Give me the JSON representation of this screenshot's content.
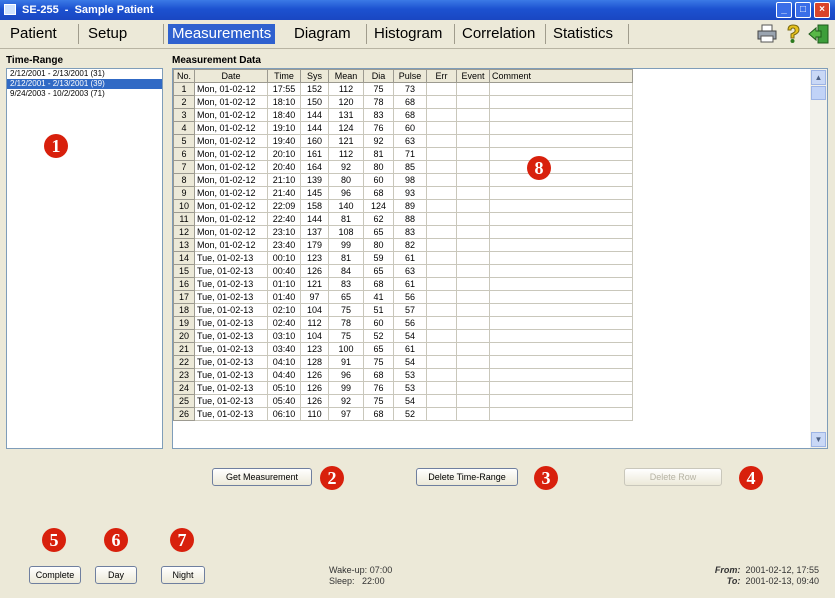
{
  "window": {
    "title": "SE-255  -  Sample Patient"
  },
  "menu": {
    "items": [
      "Patient",
      "Setup",
      "Measurements",
      "Diagram",
      "Histogram",
      "Correlation",
      "Statistics"
    ],
    "active": "Measurements"
  },
  "toolbar": {
    "icons": [
      "printer-icon",
      "help-icon",
      "exit-icon"
    ]
  },
  "time_range": {
    "label": "Time-Range",
    "items": [
      "2/12/2001 - 2/13/2001 (31)",
      "2/12/2001 - 2/13/2001 (39)",
      "9/24/2003 - 10/2/2003 (71)"
    ],
    "selected_index": 1
  },
  "measurement_data": {
    "label": "Measurement Data",
    "columns": [
      "No.",
      "Date",
      "Time",
      "Sys",
      "Mean",
      "Dia",
      "Pulse",
      "Err",
      "Event",
      "Comment"
    ],
    "rows": [
      [
        "1",
        "Mon, 01-02-12",
        "17:55",
        "152",
        "112",
        "75",
        "73"
      ],
      [
        "2",
        "Mon, 01-02-12",
        "18:10",
        "150",
        "120",
        "78",
        "68"
      ],
      [
        "3",
        "Mon, 01-02-12",
        "18:40",
        "144",
        "131",
        "83",
        "68"
      ],
      [
        "4",
        "Mon, 01-02-12",
        "19:10",
        "144",
        "124",
        "76",
        "60"
      ],
      [
        "5",
        "Mon, 01-02-12",
        "19:40",
        "160",
        "121",
        "92",
        "63"
      ],
      [
        "6",
        "Mon, 01-02-12",
        "20:10",
        "161",
        "112",
        "81",
        "71"
      ],
      [
        "7",
        "Mon, 01-02-12",
        "20:40",
        "164",
        "92",
        "80",
        "85"
      ],
      [
        "8",
        "Mon, 01-02-12",
        "21:10",
        "139",
        "80",
        "60",
        "98"
      ],
      [
        "9",
        "Mon, 01-02-12",
        "21:40",
        "145",
        "96",
        "68",
        "93"
      ],
      [
        "10",
        "Mon, 01-02-12",
        "22:09",
        "158",
        "140",
        "124",
        "89"
      ],
      [
        "11",
        "Mon, 01-02-12",
        "22:40",
        "144",
        "81",
        "62",
        "88"
      ],
      [
        "12",
        "Mon, 01-02-12",
        "23:10",
        "137",
        "108",
        "65",
        "83"
      ],
      [
        "13",
        "Mon, 01-02-12",
        "23:40",
        "179",
        "99",
        "80",
        "82"
      ],
      [
        "14",
        "Tue, 01-02-13",
        "00:10",
        "123",
        "81",
        "59",
        "61"
      ],
      [
        "15",
        "Tue, 01-02-13",
        "00:40",
        "126",
        "84",
        "65",
        "63"
      ],
      [
        "16",
        "Tue, 01-02-13",
        "01:10",
        "121",
        "83",
        "68",
        "61"
      ],
      [
        "17",
        "Tue, 01-02-13",
        "01:40",
        "97",
        "65",
        "41",
        "56"
      ],
      [
        "18",
        "Tue, 01-02-13",
        "02:10",
        "104",
        "75",
        "51",
        "57"
      ],
      [
        "19",
        "Tue, 01-02-13",
        "02:40",
        "112",
        "78",
        "60",
        "56"
      ],
      [
        "20",
        "Tue, 01-02-13",
        "03:10",
        "104",
        "75",
        "52",
        "54"
      ],
      [
        "21",
        "Tue, 01-02-13",
        "03:40",
        "123",
        "100",
        "65",
        "61"
      ],
      [
        "22",
        "Tue, 01-02-13",
        "04:10",
        "128",
        "91",
        "75",
        "54"
      ],
      [
        "23",
        "Tue, 01-02-13",
        "04:40",
        "126",
        "96",
        "68",
        "53"
      ],
      [
        "24",
        "Tue, 01-02-13",
        "05:10",
        "126",
        "99",
        "76",
        "53"
      ],
      [
        "25",
        "Tue, 01-02-13",
        "05:40",
        "126",
        "92",
        "75",
        "54"
      ],
      [
        "26",
        "Tue, 01-02-13",
        "06:10",
        "110",
        "97",
        "68",
        "52"
      ]
    ]
  },
  "buttons": {
    "get_measurement": "Get Measurement",
    "delete_time_range": "Delete Time-Range",
    "delete_row": "Delete Row",
    "complete": "Complete",
    "day": "Day",
    "night": "Night"
  },
  "callouts": {
    "c1": "1",
    "c2": "2",
    "c3": "3",
    "c4": "4",
    "c5": "5",
    "c6": "6",
    "c7": "7",
    "c8": "8"
  },
  "status": {
    "wakeup_label": "Wake-up:",
    "wakeup_value": "07:00",
    "sleep_label": "Sleep:",
    "sleep_value": "22:00",
    "from_label": "From:",
    "from_value": "2001-02-12, 17:55",
    "to_label": "To:",
    "to_value": "2001-02-13, 09:40"
  },
  "colors": {
    "accent": "#2f61cf",
    "callout": "#d8200c",
    "selection": "#316ac5"
  }
}
